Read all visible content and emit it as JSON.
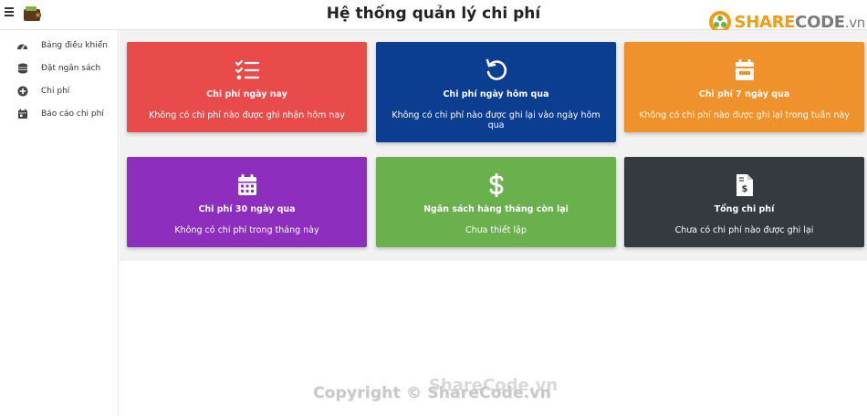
{
  "header": {
    "title": "Hệ thống quản lý chi phí",
    "brand_share": "SHARE",
    "brand_code": "CODE",
    "brand_vn": ".vn"
  },
  "sidebar": {
    "items": [
      {
        "label": "Bảng điều khiển",
        "icon": "dashboard-icon"
      },
      {
        "label": "Đặt ngân sách",
        "icon": "coins-icon"
      },
      {
        "label": "Chi phí",
        "icon": "plus-circle-icon"
      },
      {
        "label": "Báo cáo chi phí",
        "icon": "calendar-report-icon"
      }
    ]
  },
  "cards": [
    {
      "title": "Chi phí ngày nay",
      "desc": "Không có chi phí nào được ghi nhận hôm nay",
      "color": "#e94b4b",
      "icon": "checklist-icon"
    },
    {
      "title": "Chi phí ngày hôm qua",
      "desc": "Không có chi phí nào được ghi lại vào ngày hôm qua",
      "color": "#0b3d91",
      "icon": "undo-icon"
    },
    {
      "title": "Chi phí 7 ngày qua",
      "desc": "Không có chi phí nào được ghi lại trong tuần này",
      "color": "#f0922b",
      "icon": "calendar-week-icon"
    },
    {
      "title": "Chi phí 30 ngày qua",
      "desc": "Không có chi phí trong tháng này",
      "color": "#8e2ebe",
      "icon": "calendar-month-icon"
    },
    {
      "title": "Ngân sách hàng tháng còn lại",
      "desc": "Chưa thiết lập",
      "color": "#6ab04c",
      "icon": "dollar-icon"
    },
    {
      "title": "Tổng chi phí",
      "desc": "Chưa có chi phí nào được ghi lại",
      "color": "#343a40",
      "icon": "invoice-icon"
    }
  ],
  "watermark": {
    "text": "Copyright © ShareCode.vn",
    "overlay": "ShareCode.vn"
  }
}
